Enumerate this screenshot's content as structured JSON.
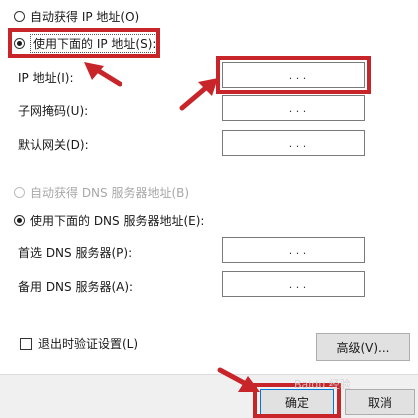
{
  "auto_ip": {
    "label": "自动获得 IP 地址(O)",
    "selected": false
  },
  "manual_ip": {
    "label": "使用下面的 IP 地址(S):",
    "selected": true
  },
  "ip_fields": [
    {
      "label": "IP 地址(I):",
      "value": ".   .   ."
    },
    {
      "label": "子网掩码(U):",
      "value": ".   .   ."
    },
    {
      "label": "默认网关(D):",
      "value": ".   .   ."
    }
  ],
  "auto_dns": {
    "label": "自动获得 DNS 服务器地址(B)",
    "selected": false,
    "disabled": true
  },
  "manual_dns": {
    "label": "使用下面的 DNS 服务器地址(E):",
    "selected": true
  },
  "dns_fields": [
    {
      "label": "首选 DNS 服务器(P):",
      "value": ".   .   ."
    },
    {
      "label": "备用 DNS 服务器(A):",
      "value": ".   .   ."
    }
  ],
  "validate_checkbox": {
    "label": "退出时验证设置(L)",
    "checked": false
  },
  "advanced_button": {
    "label": "高级(V)..."
  },
  "ok_button": {
    "label": "确定"
  },
  "cancel_button": {
    "label": "取消"
  },
  "watermark": {
    "text": "Baidu 经验"
  },
  "colors": {
    "highlight": "#c8252b",
    "accent": "#0078d7"
  }
}
